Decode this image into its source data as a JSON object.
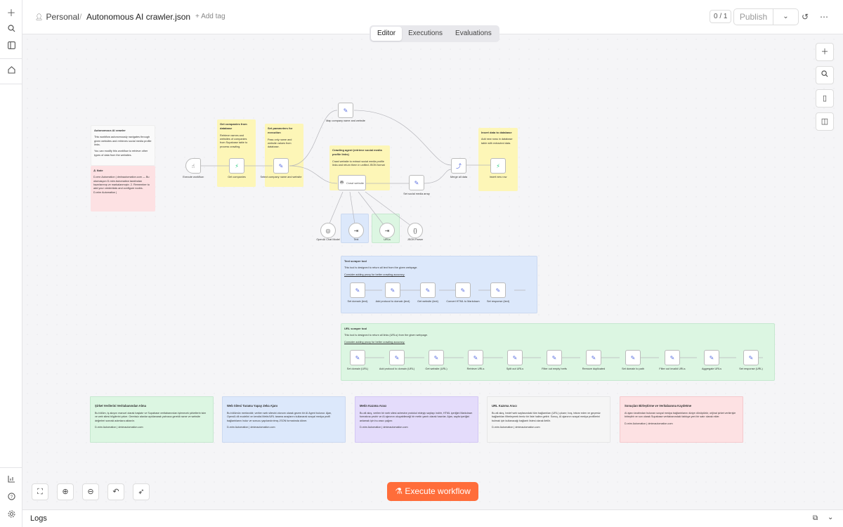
{
  "header": {
    "workspace": "Personal",
    "workflow_name": "Autonomous AI crawler.json",
    "add_tag": "+ Add tag",
    "version_counter": "0 / 1",
    "publish_label": "Publish"
  },
  "tabs": [
    {
      "label": "Editor",
      "active": true
    },
    {
      "label": "Executions",
      "active": false
    },
    {
      "label": "Evaluations",
      "active": false
    }
  ],
  "stickies": {
    "intro": {
      "title": "Autonomous AI crawler",
      "body": "This workflow autonomously navigates through given websites and retrieves social media profile links.",
      "hint": "You can modify this workflow to retrieve other types of data from the websites."
    },
    "note": {
      "title": "⚠ Note",
      "body": "D-rmn Automation | dmlnautomation.com — Bu otomasyon D-mim Automation tarafından hazırlanmış ve markalanmıştır. 2. Remember to add your credentials and configure nodes.",
      "footer": "D-mim Automation |"
    },
    "get_companies": {
      "title": "Get companies from database",
      "body": "Retrieve names and websites of companies from Supabase table to process crawling."
    },
    "set_params": {
      "title": "Set parameters for execution",
      "body": "Pass only name and website values from database."
    },
    "crawl_agent": {
      "title": "Crawling agent (retrieve social media profile links)",
      "body": "Crawl website to extract social media profile links and return them in unified JSON format"
    },
    "insert": {
      "title": "Insert data to database",
      "body": "Add new rows in database table with extracted data."
    },
    "text_tool": {
      "title": "Text scraper tool",
      "body": "This tool is designed to return all text from the given webpage.",
      "hint": "Consider adding proxy for better crawling accuracy."
    },
    "url_tool": {
      "title": "URL scraper tool",
      "body": "This tool is designed to return all links (URLs) from the given webpage.",
      "hint": "Consider adding proxy for better crawling accuracy."
    }
  },
  "nodes": {
    "execute_workflow": "Execute workflow",
    "get_companies": "Get companies",
    "select_company": "Select company name and website",
    "map_company": "Map company name and website",
    "crawl_website": "Crawl website",
    "openai_model": "OpenAI Chat Model",
    "text": "Text",
    "urls": "URLs",
    "json_parser": "JSON Parser",
    "set_social": "Set social media array",
    "merge_all": "Merge all data",
    "insert_row": "Insert new row",
    "text_nodes": [
      "Set domain (text)",
      "Add protocol to domain (text)",
      "Get website (text)",
      "Convert HTML to Markdown",
      "Set response (text)"
    ],
    "url_nodes": [
      "Set domain (URL)",
      "Add protocol to domain (URL)",
      "Get website (URL)",
      "Retrieve URLs",
      "Split out URLs",
      "Filter out empty hrefs",
      "Remove duplicated",
      "Set domain to path",
      "Filter out invalid URLs",
      "Aggregate URLs",
      "Set response (URL)"
    ]
  },
  "notes": [
    {
      "title": "Şirket Verilerini Veritabanından Alma",
      "body": "Bu bölüm, iş akışını manuel olarak başlatır ve Supabase veritabanından işlenecek şirketlerin isim ve web sitesi bilgilerini çeker. Gereksiz alanlar ayıklanarak yalnızca gerekli name ve website değerleri sonraki adımlara aktarılır.",
      "footer": "D-mim Automation | dmimautomation.com"
    },
    {
      "title": "Web Sitesi Tarama Yapay Zeka Ajanı",
      "body": "Bu bölümün merkezidir, verilen web sitesini otonom olarak gezen bir AI Agent bulunur. Ajan, OpenAI dil modelini ve kendisi Metin/URL tarama araçlarını kullanarak sosyal medya profil bağlantılarını bulur ve sonucu yapılandırılmış JSON formatında döner.",
      "footer": "D-mim Automation | dmimautomation.com"
    },
    {
      "title": "Metin Kazıma Aracı",
      "body": "Bu alt akış, verilen bir web sitesi adresine protokol ekleyip sayfayı indirir, HTML içeriğini Markdown formatına çevirir ve AI ajanının okuyabileceği bir metin yanıtı olarak hazırlar. Ajan, sayfa içeriğini anlamak için bu aracı çağırır.",
      "footer": "D-mim Automation | dmimautomation.com"
    },
    {
      "title": "URL Kazıma Aracı",
      "body": "Bu alt akış, hedef web sayfasındaki tüm bağlantıları (URL) çıkarır; boş, tekrar eden ve geçersiz bağlantıları filtreleyerek temiz bir liste haline getirir. Sonuç, AI ajanının sosyal medya profillerini bulmak için kullanacağı bağlantı listesi olarak iletilir.",
      "footer": "D-mim Automation | dmimautomation.com"
    },
    {
      "title": "Sonuçları Birleştirme ve Veritabanına Kaydetme",
      "body": "AI ajanı tarafından bulunan sosyal medya bağlantılarını diziye dönüştürür, orijinal şirket verileriyle birleştirir ve son olarak Supabase veritabanındaki tabloya yeni bir satır olarak ekler.",
      "footer": "D-mim Automation | dmimautomation.com"
    }
  ],
  "execute_button": "Execute workflow",
  "logs_label": "Logs",
  "colors": {
    "accent": "#ff6d3a",
    "canvas": "#f5f5f7"
  }
}
